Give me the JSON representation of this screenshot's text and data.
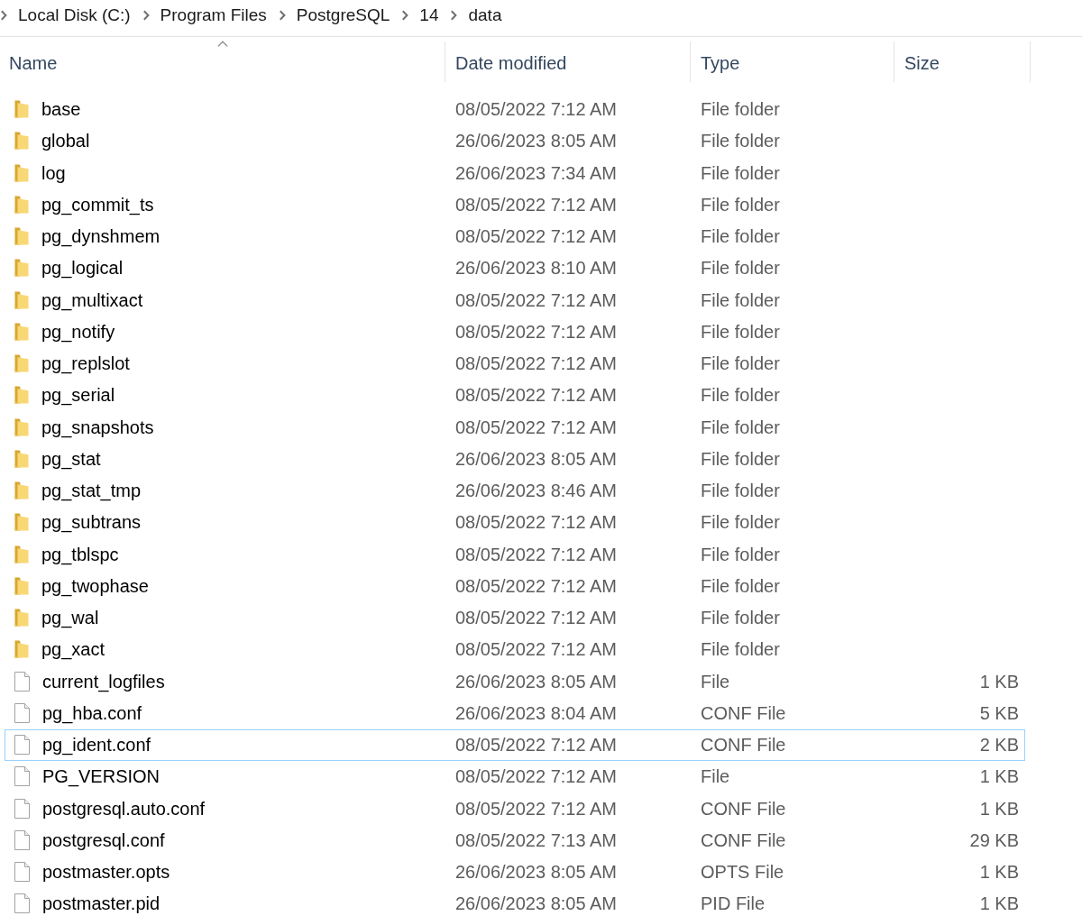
{
  "breadcrumb": [
    "Local Disk (C:)",
    "Program Files",
    "PostgreSQL",
    "14",
    "data"
  ],
  "columns": [
    {
      "label": "Name",
      "sorted": true
    },
    {
      "label": "Date modified",
      "sorted": false
    },
    {
      "label": "Type",
      "sorted": false
    },
    {
      "label": "Size",
      "sorted": false
    }
  ],
  "rows": [
    {
      "kind": "folder",
      "name": "base",
      "date": "08/05/2022 7:12 AM",
      "type": "File folder",
      "focused": false
    },
    {
      "kind": "folder",
      "name": "global",
      "date": "26/06/2023 8:05 AM",
      "type": "File folder",
      "focused": false
    },
    {
      "kind": "folder",
      "name": "log",
      "date": "26/06/2023 7:34 AM",
      "type": "File folder",
      "focused": false
    },
    {
      "kind": "folder",
      "name": "pg_commit_ts",
      "date": "08/05/2022 7:12 AM",
      "type": "File folder",
      "focused": false
    },
    {
      "kind": "folder",
      "name": "pg_dynshmem",
      "date": "08/05/2022 7:12 AM",
      "type": "File folder",
      "focused": false
    },
    {
      "kind": "folder",
      "name": "pg_logical",
      "date": "26/06/2023 8:10 AM",
      "type": "File folder",
      "focused": false
    },
    {
      "kind": "folder",
      "name": "pg_multixact",
      "date": "08/05/2022 7:12 AM",
      "type": "File folder",
      "focused": false
    },
    {
      "kind": "folder",
      "name": "pg_notify",
      "date": "08/05/2022 7:12 AM",
      "type": "File folder",
      "focused": false
    },
    {
      "kind": "folder",
      "name": "pg_replslot",
      "date": "08/05/2022 7:12 AM",
      "type": "File folder",
      "focused": false
    },
    {
      "kind": "folder",
      "name": "pg_serial",
      "date": "08/05/2022 7:12 AM",
      "type": "File folder",
      "focused": false
    },
    {
      "kind": "folder",
      "name": "pg_snapshots",
      "date": "08/05/2022 7:12 AM",
      "type": "File folder",
      "focused": false
    },
    {
      "kind": "folder",
      "name": "pg_stat",
      "date": "26/06/2023 8:05 AM",
      "type": "File folder",
      "focused": false
    },
    {
      "kind": "folder",
      "name": "pg_stat_tmp",
      "date": "26/06/2023 8:46 AM",
      "type": "File folder",
      "focused": false
    },
    {
      "kind": "folder",
      "name": "pg_subtrans",
      "date": "08/05/2022 7:12 AM",
      "type": "File folder",
      "focused": false
    },
    {
      "kind": "folder",
      "name": "pg_tblspc",
      "date": "08/05/2022 7:12 AM",
      "type": "File folder",
      "focused": false
    },
    {
      "kind": "folder",
      "name": "pg_twophase",
      "date": "08/05/2022 7:12 AM",
      "type": "File folder",
      "focused": false
    },
    {
      "kind": "folder",
      "name": "pg_wal",
      "date": "08/05/2022 7:12 AM",
      "type": "File folder",
      "focused": false
    },
    {
      "kind": "folder",
      "name": "pg_xact",
      "date": "08/05/2022 7:12 AM",
      "type": "File folder",
      "focused": false
    },
    {
      "kind": "file",
      "name": "current_logfiles",
      "date": "26/06/2023 8:05 AM",
      "type": "File",
      "size": "1 KB",
      "focused": false
    },
    {
      "kind": "file",
      "name": "pg_hba.conf",
      "date": "26/06/2023 8:04 AM",
      "type": "CONF File",
      "size": "5 KB",
      "focused": false
    },
    {
      "kind": "file",
      "name": "pg_ident.conf",
      "date": "08/05/2022 7:12 AM",
      "type": "CONF File",
      "size": "2 KB",
      "focused": true
    },
    {
      "kind": "file",
      "name": "PG_VERSION",
      "date": "08/05/2022 7:12 AM",
      "type": "File",
      "size": "1 KB",
      "focused": false
    },
    {
      "kind": "file",
      "name": "postgresql.auto.conf",
      "date": "08/05/2022 7:12 AM",
      "type": "CONF File",
      "size": "1 KB",
      "focused": false
    },
    {
      "kind": "file",
      "name": "postgresql.conf",
      "date": "08/05/2022 7:13 AM",
      "type": "CONF File",
      "size": "29 KB",
      "focused": false
    },
    {
      "kind": "file",
      "name": "postmaster.opts",
      "date": "26/06/2023 8:05 AM",
      "type": "OPTS File",
      "size": "1 KB",
      "focused": false
    },
    {
      "kind": "file",
      "name": "postmaster.pid",
      "date": "26/06/2023 8:05 AM",
      "type": "PID File",
      "size": "1 KB",
      "focused": false
    }
  ]
}
